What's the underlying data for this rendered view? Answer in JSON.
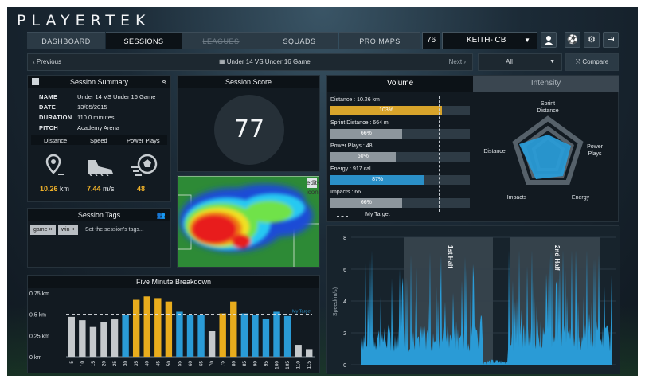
{
  "brand": "PLAYERTEK",
  "nav": {
    "tabs": [
      "DASHBOARD",
      "SESSIONS",
      "LEAGUES",
      "SQUADS",
      "PRO MAPS"
    ],
    "active": 1,
    "disabled": [
      2
    ]
  },
  "user": {
    "number": "76",
    "name": "KEITH- CB"
  },
  "session_nav": {
    "previous": "Previous",
    "title": "Under 14 VS Under 16 Game",
    "next": "Next",
    "filter": "All",
    "compare": "Compare"
  },
  "summary": {
    "title": "Session Summary",
    "fields": [
      {
        "label": "NAME",
        "value": "Under 14 VS Under 16 Game"
      },
      {
        "label": "DATE",
        "value": "13/05/2015"
      },
      {
        "label": "DURATION",
        "value": "110.0 minutes"
      },
      {
        "label": "PITCH",
        "value": "Academy Arena"
      }
    ],
    "stats": [
      {
        "label": "Distance",
        "value": "10.26",
        "unit": "km"
      },
      {
        "label": "Speed",
        "value": "7.44",
        "unit": "m/s"
      },
      {
        "label": "Power Plays",
        "value": "48",
        "unit": ""
      }
    ]
  },
  "tags": {
    "title": "Session Tags",
    "items": [
      "game",
      "win"
    ],
    "placeholder": "Set the session's tags..."
  },
  "score": {
    "title": "Session Score",
    "value": "77"
  },
  "heatmap": {
    "edit_icon": "edit-icon"
  },
  "volume": {
    "tabs": [
      "Volume",
      "Intensity"
    ],
    "target_label": "My Target",
    "bars": [
      {
        "label": "Distance : 10.26 km",
        "pct": 103,
        "color": "#d8a42b"
      },
      {
        "label": "Sprint Distance : 664 m",
        "pct": 66,
        "color": "#8d969d"
      },
      {
        "label": "Power Plays : 48",
        "pct": 60,
        "color": "#8d969d"
      },
      {
        "label": "Energy : 917 cal",
        "pct": 87,
        "color": "#2a8fc7"
      },
      {
        "label": "Impacts : 66",
        "pct": 66,
        "color": "#8d969d"
      }
    ],
    "radar": {
      "labels": [
        "Sprint Distance",
        "Power Plays",
        "Energy",
        "Impacts",
        "Distance"
      ]
    }
  },
  "chart_data": [
    {
      "type": "bar",
      "title": "Five Minute Breakdown",
      "categories": [
        "5",
        "10",
        "15",
        "20",
        "25",
        "30",
        "35",
        "40",
        "45",
        "50",
        "55",
        "60",
        "65",
        "70",
        "75",
        "80",
        "85",
        "90",
        "95",
        "100",
        "105",
        "110",
        "115"
      ],
      "values": [
        0.47,
        0.43,
        0.35,
        0.41,
        0.44,
        0.49,
        0.67,
        0.71,
        0.69,
        0.65,
        0.53,
        0.49,
        0.49,
        0.3,
        0.51,
        0.65,
        0.51,
        0.49,
        0.45,
        0.53,
        0.48,
        0.14,
        0.09
      ],
      "colors": [
        "#c5c9cc",
        "#c5c9cc",
        "#c5c9cc",
        "#c5c9cc",
        "#c5c9cc",
        "#2a9bd6",
        "#e8ac1d",
        "#e8ac1d",
        "#e8ac1d",
        "#e8ac1d",
        "#2a9bd6",
        "#2a9bd6",
        "#2a9bd6",
        "#c5c9cc",
        "#e8ac1d",
        "#e8ac1d",
        "#2a9bd6",
        "#2a9bd6",
        "#2a9bd6",
        "#2a9bd6",
        "#2a9bd6",
        "#c5c9cc",
        "#c5c9cc"
      ],
      "ytick_labels": [
        "0 km",
        "0.25 km",
        "0.5 km",
        "0.75 km"
      ],
      "ylim": [
        0,
        0.75
      ],
      "target": 0.5,
      "target_label": "My Target"
    },
    {
      "type": "area",
      "ylabel": "Speed(m/s)",
      "ylim": [
        0,
        8
      ],
      "yticks": [
        0,
        2,
        4,
        6,
        8
      ],
      "annotations": [
        "1st Half",
        "2nd Half"
      ]
    }
  ]
}
